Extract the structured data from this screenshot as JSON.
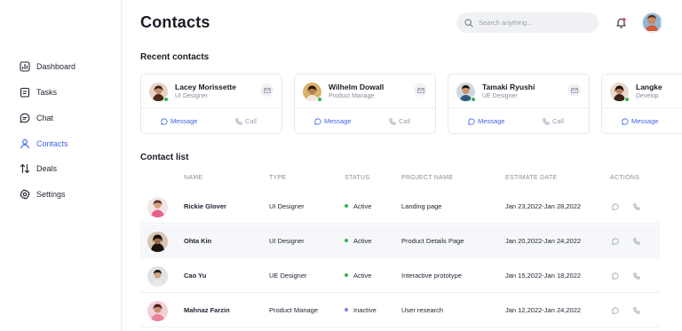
{
  "sidebar": {
    "items": [
      {
        "label": "Dashboard",
        "icon": "chart-icon",
        "active": false
      },
      {
        "label": "Tasks",
        "icon": "clipboard-icon",
        "active": false
      },
      {
        "label": "Chat",
        "icon": "chat-icon",
        "active": false
      },
      {
        "label": "Contacts",
        "icon": "user-icon",
        "active": true
      },
      {
        "label": "Deals",
        "icon": "arrows-icon",
        "active": false
      },
      {
        "label": "Settings",
        "icon": "gear-icon",
        "active": false
      }
    ]
  },
  "header": {
    "title": "Contacts",
    "search_placeholder": "Search anything...",
    "notification_dot_color": "#e84a4a"
  },
  "recent": {
    "title": "Recent contacts",
    "message_label": "Message",
    "call_label": "Call",
    "cards": [
      {
        "name": "Lacey Morissette",
        "role": "UI Designer"
      },
      {
        "name": "Wilhelm Dowall",
        "role": "Product Manage"
      },
      {
        "name": "Tamaki Ryushi",
        "role": "UE Designer"
      },
      {
        "name": "Langke",
        "role": "Develop"
      }
    ]
  },
  "contacts": {
    "title": "Contact list",
    "columns": [
      "NAME",
      "TYPE",
      "STATUS",
      "PROJECT NAME",
      "ESTIMATE DATE",
      "ACTIONS"
    ],
    "rows": [
      {
        "name": "Rickie Glover",
        "type": "UI Designer",
        "status": "Active",
        "project": "Landing page",
        "date": "Jan 23,2022-Jan 28,2022"
      },
      {
        "name": "Ohta Kin",
        "type": "UI Designer",
        "status": "Active",
        "project": "Product Details Page",
        "date": "Jan 20,2022-Jan 24,2022"
      },
      {
        "name": "Cao Yu",
        "type": "UE Designer",
        "status": "Active",
        "project": "Interactive prototype",
        "date": "Jan 15,2022-Jan 18,2022"
      },
      {
        "name": "Mahnaz Farzin",
        "type": "Product Manage",
        "status": "Inactive",
        "project": "User research",
        "date": "Jan 12,2022-Jan 24,2022"
      }
    ]
  },
  "colors": {
    "accent": "#3d63e5",
    "active_status": "#35b34a",
    "inactive_status": "#8b7cf0"
  }
}
